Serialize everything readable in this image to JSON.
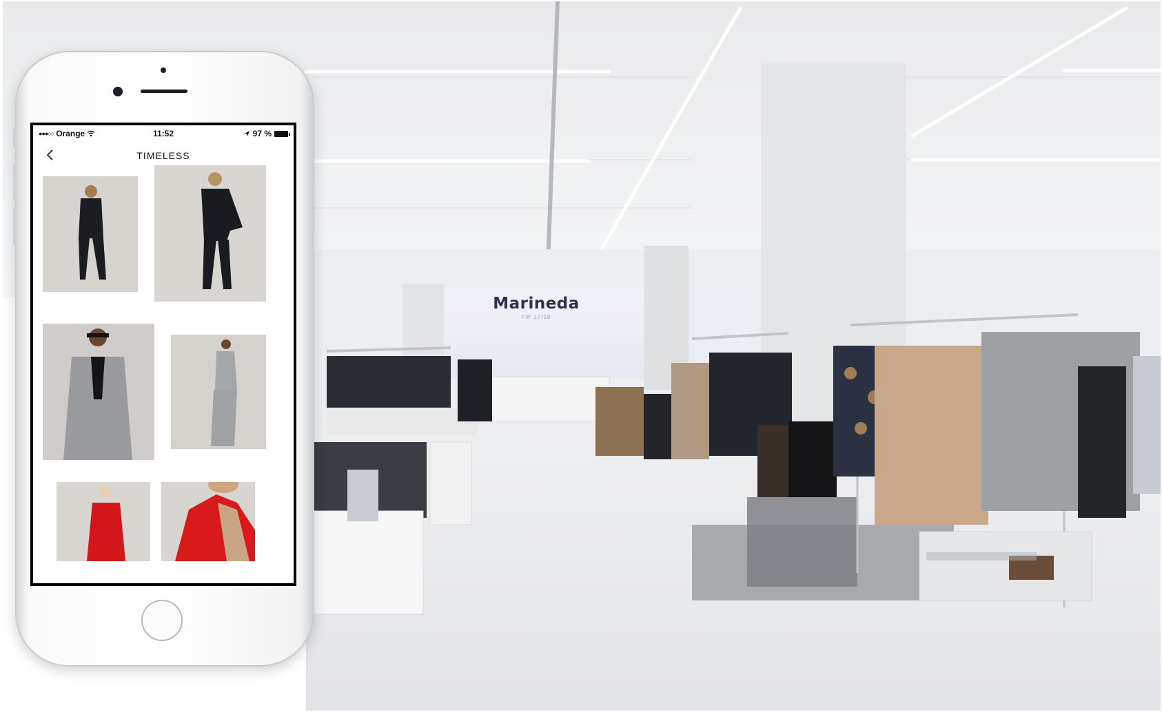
{
  "store": {
    "sign_name": "Marineda",
    "sign_subtitle": "FW 17/18"
  },
  "phone": {
    "status_bar": {
      "carrier": "Orange",
      "time": "11:52",
      "battery": "97 %"
    },
    "nav": {
      "title": "TIMELESS"
    },
    "gallery": [
      {
        "outfit": "black suit, back view",
        "color": "#1c1d22"
      },
      {
        "outfit": "black suit, front view",
        "color": "#1a1b20"
      },
      {
        "outfit": "grey checked blazer",
        "color": "#9a9b9e"
      },
      {
        "outfit": "grey suit, full length",
        "color": "#a4a7aa"
      },
      {
        "outfit": "red coat, full length",
        "color": "#d3161c"
      },
      {
        "outfit": "red coat, close up",
        "color": "#d81a1d"
      }
    ]
  },
  "colors": {
    "store_wall": "#f3f4f6",
    "store_floor": "#e7e8ea",
    "accent_red": "#d3161c"
  }
}
